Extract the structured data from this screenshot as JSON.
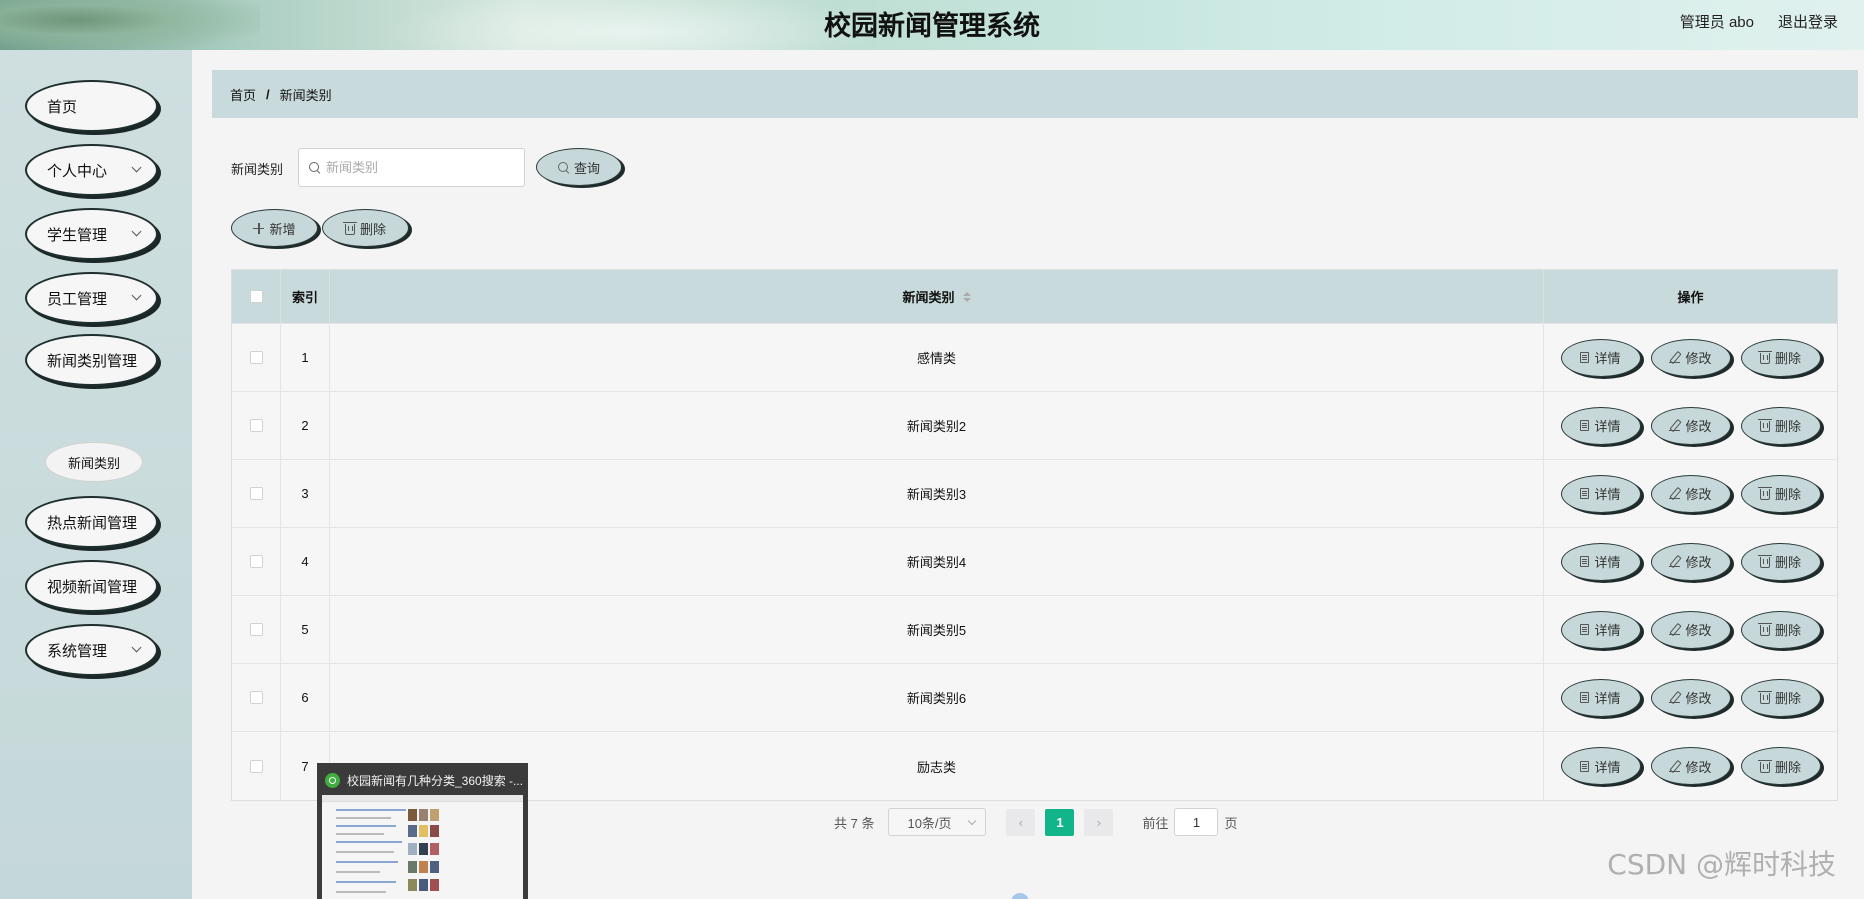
{
  "header": {
    "title": "校园新闻管理系统",
    "user_label": "管理员 abo",
    "logout_label": "退出登录"
  },
  "sidebar": {
    "items": [
      {
        "label": "首页",
        "has_children": false
      },
      {
        "label": "个人中心",
        "has_children": true
      },
      {
        "label": "学生管理",
        "has_children": true
      },
      {
        "label": "员工管理",
        "has_children": true
      },
      {
        "label": "新闻类别管理",
        "has_children": true
      },
      {
        "label": "热点新闻管理",
        "has_children": true
      },
      {
        "label": "视频新闻管理",
        "has_children": true
      },
      {
        "label": "系统管理",
        "has_children": true
      }
    ],
    "active_submenu": "新闻类别"
  },
  "breadcrumb": {
    "home": "首页",
    "separator": "/",
    "current": "新闻类别"
  },
  "search": {
    "label": "新闻类别",
    "placeholder": "新闻类别",
    "value": "",
    "button_label": "查询"
  },
  "toolbar": {
    "add_label": "新增",
    "delete_label": "删除"
  },
  "table": {
    "columns": {
      "index": "索引",
      "category": "新闻类别",
      "actions": "操作"
    },
    "rows": [
      {
        "index": "1",
        "category": "感情类"
      },
      {
        "index": "2",
        "category": "新闻类别2"
      },
      {
        "index": "3",
        "category": "新闻类别3"
      },
      {
        "index": "4",
        "category": "新闻类别4"
      },
      {
        "index": "5",
        "category": "新闻类别5"
      },
      {
        "index": "6",
        "category": "新闻类别6"
      },
      {
        "index": "7",
        "category": "励志类"
      }
    ],
    "row_actions": {
      "detail": "详情",
      "edit": "修改",
      "delete": "删除"
    }
  },
  "pagination": {
    "total_label": "共 7 条",
    "page_size": "10条/页",
    "prev": "‹",
    "current_page": "1",
    "next": "›",
    "goto_label": "前往",
    "goto_value": "1",
    "goto_suffix": "页"
  },
  "taskbar_preview": {
    "title": "校园新闻有几种分类_360搜索 -..."
  },
  "watermark": "CSDN @辉时科技",
  "colors": {
    "accent": "#12b58a",
    "table_header_bg": "#c8dadb",
    "sidebar_bg": "#c5d8d9",
    "button_bg": "#c6d8d9"
  }
}
